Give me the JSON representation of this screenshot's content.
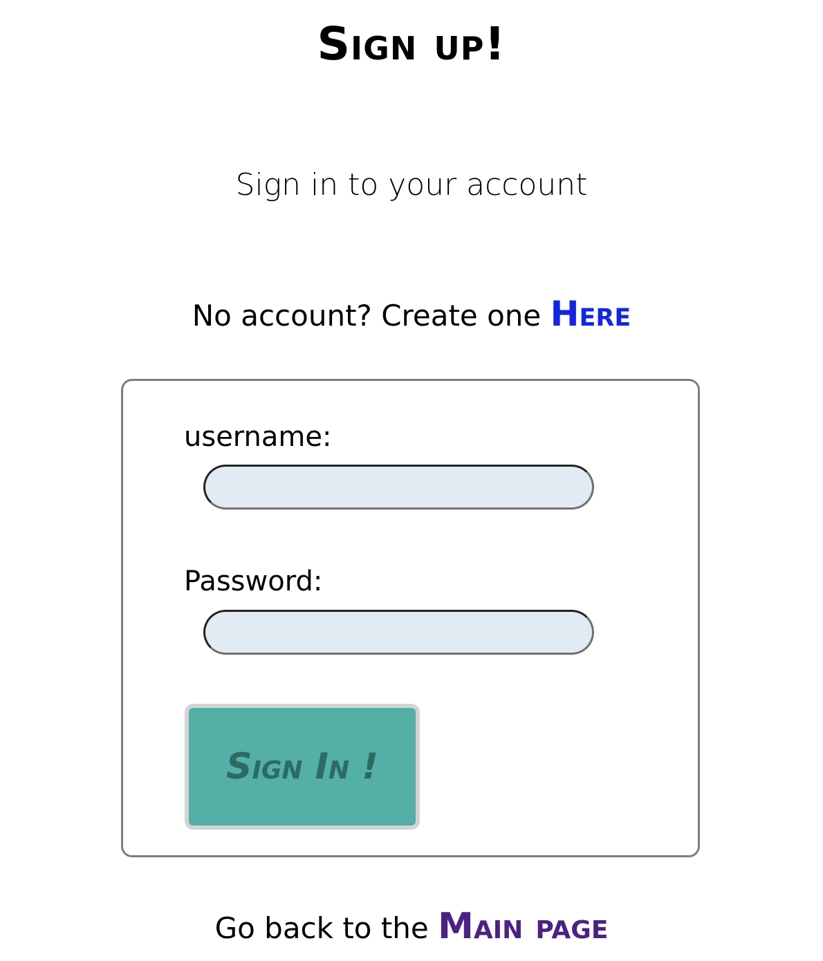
{
  "header": {
    "title": "Sign up!"
  },
  "intro": {
    "subtitle": "Sign in to your account",
    "no_account_text": "No account? Create one ",
    "create_link_label": "Here"
  },
  "form": {
    "username_label": "username:",
    "username_value": "",
    "password_label": "Password:",
    "password_value": "",
    "submit_label": "Sign In !"
  },
  "footer": {
    "back_text": "Go back to the ",
    "main_link_label": "Main page"
  },
  "colors": {
    "create_link": "#1426e0",
    "main_link": "#4b2283",
    "button_background": "#54afa6",
    "button_text": "#2c6a62",
    "input_background": "#e2eaf4"
  }
}
